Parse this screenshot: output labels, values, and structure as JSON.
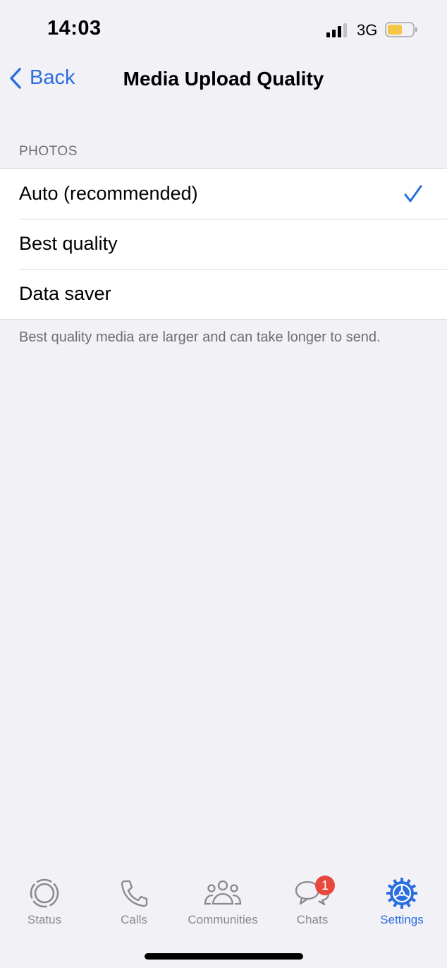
{
  "status_bar": {
    "time": "14:03",
    "network": "3G",
    "signal_bars_filled": 3,
    "signal_bars_total": 4,
    "battery_level": 0.55,
    "battery_color": "#f5c643"
  },
  "nav": {
    "back_label": "Back",
    "title": "Media Upload Quality"
  },
  "section": {
    "header": "PHOTOS",
    "options": [
      {
        "label": "Auto (recommended)",
        "selected": true
      },
      {
        "label": "Best quality",
        "selected": false
      },
      {
        "label": "Data saver",
        "selected": false
      }
    ],
    "footer": "Best quality media are larger and can take longer to send."
  },
  "tabbar": {
    "tabs": [
      {
        "label": "Status",
        "icon": "status-icon"
      },
      {
        "label": "Calls",
        "icon": "phone-icon"
      },
      {
        "label": "Communities",
        "icon": "communities-icon"
      },
      {
        "label": "Chats",
        "icon": "chats-icon",
        "badge": "1"
      },
      {
        "label": "Settings",
        "icon": "gear-icon",
        "active": true
      }
    ]
  },
  "colors": {
    "accent": "#2a6ee0",
    "badge": "#e8473c",
    "background": "#f2f1f6"
  }
}
